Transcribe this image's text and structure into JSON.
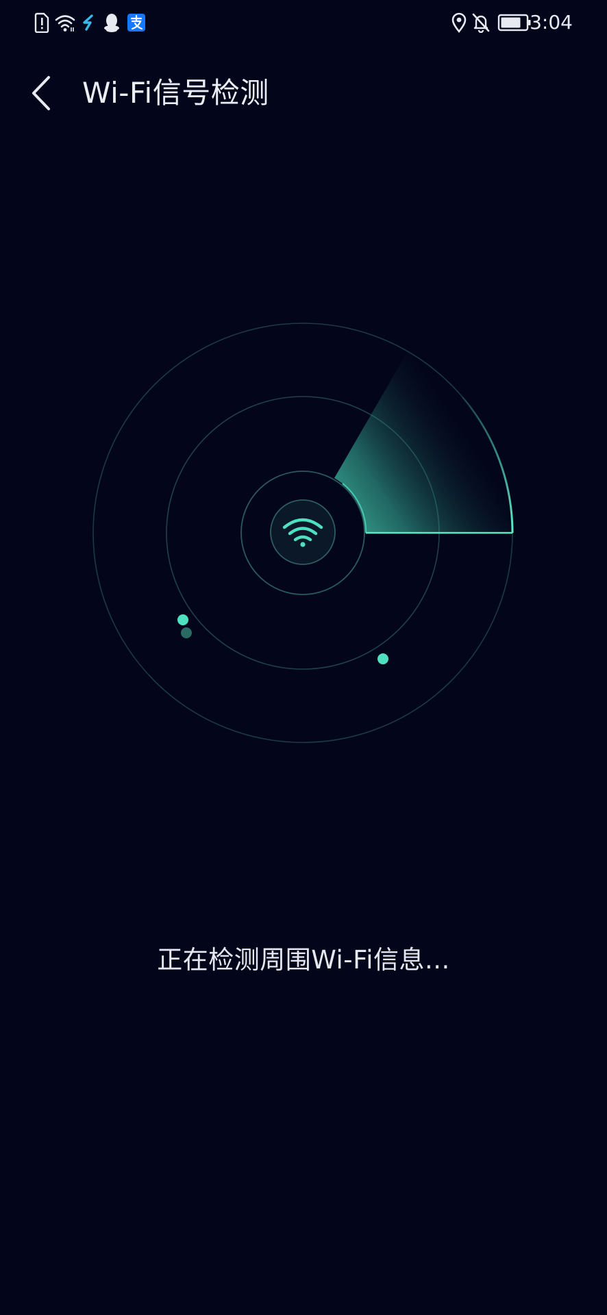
{
  "status_bar": {
    "time": "3:04",
    "left_icons": [
      "sim-alert-icon",
      "wifi-signal-icon",
      "sync-app-icon",
      "qq-icon",
      "alipay-icon"
    ],
    "right_icons": [
      "location-icon",
      "notifications-off-icon",
      "battery-icon"
    ],
    "battery_level": 0.8
  },
  "app_bar": {
    "back_icon": "chevron-left-icon",
    "title": "Wi-Fi信号检测"
  },
  "radar": {
    "center_icon": "wifi-icon",
    "accent_color": "#4fe0bf",
    "ring_color": "#1f4a50",
    "detected_dots": 3
  },
  "scan": {
    "message": "正在检测周围Wi-Fi信息..."
  },
  "colors": {
    "background": "#03051a",
    "text": "#e8eaf2",
    "accent": "#4fe0bf"
  }
}
